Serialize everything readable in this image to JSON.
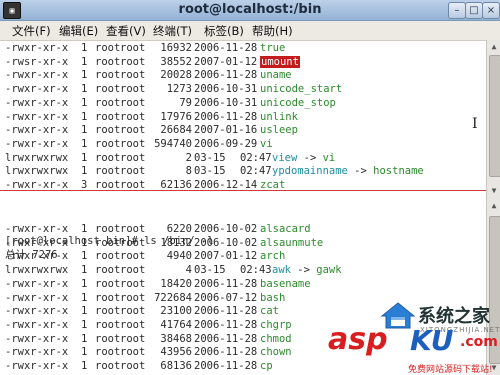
{
  "window": {
    "title": "root@localhost:/bin",
    "system_icon_label": "▣"
  },
  "window_controls": {
    "minimize": "–",
    "maximize": "□",
    "close": "×"
  },
  "menu": [
    "文件(F)",
    "编辑(E)",
    "查看(V)",
    "终端(T)",
    "标签(B)",
    "帮助(H)"
  ],
  "top_listing": [
    {
      "perm": "-rwxr-xr-x",
      "links": "1",
      "owner": "root",
      "group": "root",
      "size": "16932",
      "date": "2006-11-28",
      "time": "",
      "name": "true",
      "target": "",
      "style": "green"
    },
    {
      "perm": "-rwsr-xr-x",
      "links": "1",
      "owner": "root",
      "group": "root",
      "size": "38552",
      "date": "2007-01-12",
      "time": "",
      "name": "umount",
      "target": "",
      "style": "highlight"
    },
    {
      "perm": "-rwxr-xr-x",
      "links": "1",
      "owner": "root",
      "group": "root",
      "size": "20028",
      "date": "2006-11-28",
      "time": "",
      "name": "uname",
      "target": "",
      "style": "green"
    },
    {
      "perm": "-rwxr-xr-x",
      "links": "1",
      "owner": "root",
      "group": "root",
      "size": "1273",
      "date": "2006-10-31",
      "time": "",
      "name": "unicode_start",
      "target": "",
      "style": "green"
    },
    {
      "perm": "-rwxr-xr-x",
      "links": "1",
      "owner": "root",
      "group": "root",
      "size": "79",
      "date": "2006-10-31",
      "time": "",
      "name": "unicode_stop",
      "target": "",
      "style": "green"
    },
    {
      "perm": "-rwxr-xr-x",
      "links": "1",
      "owner": "root",
      "group": "root",
      "size": "17976",
      "date": "2006-11-28",
      "time": "",
      "name": "unlink",
      "target": "",
      "style": "green"
    },
    {
      "perm": "-rwxr-xr-x",
      "links": "1",
      "owner": "root",
      "group": "root",
      "size": "26684",
      "date": "2007-01-16",
      "time": "",
      "name": "usleep",
      "target": "",
      "style": "green"
    },
    {
      "perm": "-rwxr-xr-x",
      "links": "1",
      "owner": "root",
      "group": "root",
      "size": "594740",
      "date": "2006-09-29",
      "time": "",
      "name": "vi",
      "target": "",
      "style": "green"
    },
    {
      "perm": "lrwxrwxrwx",
      "links": "1",
      "owner": "root",
      "group": "root",
      "size": "2",
      "date": "03-15",
      "time": "02:47",
      "name": "view",
      "target": "vi",
      "style": "cyan"
    },
    {
      "perm": "lrwxrwxrwx",
      "links": "1",
      "owner": "root",
      "group": "root",
      "size": "8",
      "date": "03-15",
      "time": "02:47",
      "name": "ypdomainname",
      "target": "hostname",
      "style": "cyan"
    },
    {
      "perm": "-rwxr-xr-x",
      "links": "3",
      "owner": "root",
      "group": "root",
      "size": "62136",
      "date": "2006-12-14",
      "time": "",
      "name": "zcat",
      "target": "",
      "style": "green"
    }
  ],
  "prompt": {
    "text": "[root@localhost bin]# ls /bin/ -l"
  },
  "total": {
    "text": "总计 7276"
  },
  "bottom_listing": [
    {
      "perm": "-rwxr-xr-x",
      "links": "1",
      "owner": "root",
      "group": "root",
      "size": "6220",
      "date": "2006-10-02",
      "time": "",
      "name": "alsacard",
      "target": "",
      "style": "green"
    },
    {
      "perm": "-rwxr-xr-x",
      "links": "1",
      "owner": "root",
      "group": "root",
      "size": "18132",
      "date": "2006-10-02",
      "time": "",
      "name": "alsaunmute",
      "target": "",
      "style": "green"
    },
    {
      "perm": "-rwxr-xr-x",
      "links": "1",
      "owner": "root",
      "group": "root",
      "size": "4940",
      "date": "2007-01-12",
      "time": "",
      "name": "arch",
      "target": "",
      "style": "green"
    },
    {
      "perm": "lrwxrwxrwx",
      "links": "1",
      "owner": "root",
      "group": "root",
      "size": "4",
      "date": "03-15",
      "time": "02:43",
      "name": "awk",
      "target": "gawk",
      "style": "cyan"
    },
    {
      "perm": "-rwxr-xr-x",
      "links": "1",
      "owner": "root",
      "group": "root",
      "size": "18420",
      "date": "2006-11-28",
      "time": "",
      "name": "basename",
      "target": "",
      "style": "green"
    },
    {
      "perm": "-rwxr-xr-x",
      "links": "1",
      "owner": "root",
      "group": "root",
      "size": "722684",
      "date": "2006-07-12",
      "time": "",
      "name": "bash",
      "target": "",
      "style": "green"
    },
    {
      "perm": "-rwxr-xr-x",
      "links": "1",
      "owner": "root",
      "group": "root",
      "size": "23100",
      "date": "2006-11-28",
      "time": "",
      "name": "cat",
      "target": "",
      "style": "green"
    },
    {
      "perm": "-rwxr-xr-x",
      "links": "1",
      "owner": "root",
      "group": "root",
      "size": "41764",
      "date": "2006-11-28",
      "time": "",
      "name": "chgrp",
      "target": "",
      "style": "green"
    },
    {
      "perm": "-rwxr-xr-x",
      "links": "1",
      "owner": "root",
      "group": "root",
      "size": "38468",
      "date": "2006-11-28",
      "time": "",
      "name": "chmod",
      "target": "",
      "style": "green"
    },
    {
      "perm": "-rwxr-xr-x",
      "links": "1",
      "owner": "root",
      "group": "root",
      "size": "43956",
      "date": "2006-11-28",
      "time": "",
      "name": "chown",
      "target": "",
      "style": "green"
    },
    {
      "perm": "-rwxr-xr-x",
      "links": "1",
      "owner": "root",
      "group": "root",
      "size": "68136",
      "date": "2006-11-28",
      "time": "",
      "name": "cp",
      "target": "",
      "style": "green"
    }
  ],
  "scrollbar": {
    "up_icon": "▲",
    "down_icon": "▼"
  },
  "watermark": {
    "brand_cn": "系统之家",
    "url_text": "XITONGZHIJIA.NET",
    "asp": "asp",
    "ku": "KU",
    "net": ".com",
    "sub": "免费网站源码下载站!"
  },
  "colors": {
    "green_file": "#2d8a2d",
    "cyan_link": "#1f8ea0",
    "highlight_bg": "#c41c1c"
  }
}
